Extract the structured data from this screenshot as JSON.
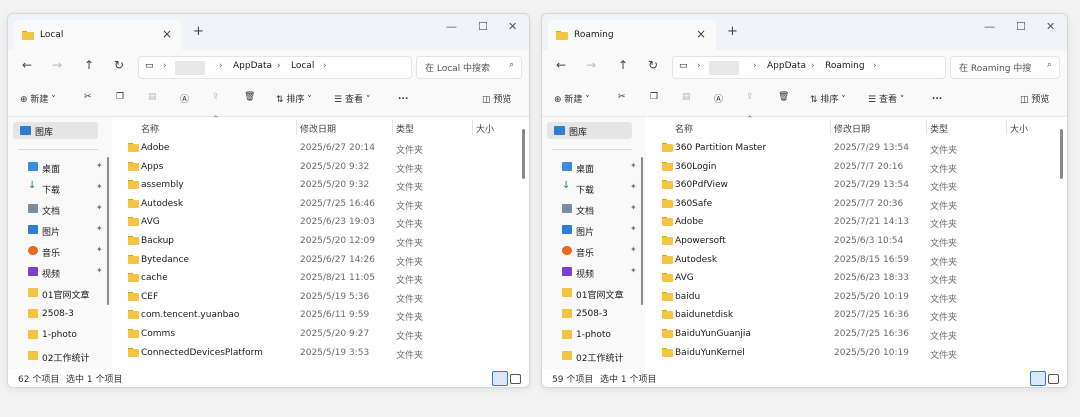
{
  "windows": [
    {
      "tab_title": "Local",
      "path": [
        "AppData",
        "Local"
      ],
      "search_placeholder": "在 Local 中搜索",
      "toolbar": {
        "new": "新建",
        "sort": "排序",
        "view": "查看",
        "more": "...",
        "preview": "预览"
      },
      "columns": {
        "name": "名称",
        "date": "修改日期",
        "type": "类型",
        "size": "大小"
      },
      "sidebar": {
        "gallery": "图库",
        "items": [
          "桌面",
          "下载",
          "文档",
          "图片",
          "音乐",
          "视频",
          "01官网文章",
          "2508-3",
          "1-photo",
          "02工作统计"
        ]
      },
      "files": [
        {
          "name": "Adobe",
          "date": "2025/6/27 20:14",
          "type": "文件夹"
        },
        {
          "name": "Apps",
          "date": "2025/5/20 9:32",
          "type": "文件夹"
        },
        {
          "name": "assembly",
          "date": "2025/5/20 9:32",
          "type": "文件夹"
        },
        {
          "name": "Autodesk",
          "date": "2025/7/25 16:46",
          "type": "文件夹"
        },
        {
          "name": "AVG",
          "date": "2025/6/23 19:03",
          "type": "文件夹"
        },
        {
          "name": "Backup",
          "date": "2025/5/20 12:09",
          "type": "文件夹"
        },
        {
          "name": "Bytedance",
          "date": "2025/6/27 14:26",
          "type": "文件夹"
        },
        {
          "name": "cache",
          "date": "2025/8/21 11:05",
          "type": "文件夹"
        },
        {
          "name": "CEF",
          "date": "2025/5/19 5:36",
          "type": "文件夹"
        },
        {
          "name": "com.tencent.yuanbao",
          "date": "2025/6/11 9:59",
          "type": "文件夹"
        },
        {
          "name": "Comms",
          "date": "2025/5/20 9:27",
          "type": "文件夹"
        },
        {
          "name": "ConnectedDevicesPlatform",
          "date": "2025/5/19 3:53",
          "type": "文件夹"
        }
      ],
      "status": {
        "count": "62 个项目",
        "selected": "选中 1 个项目"
      }
    },
    {
      "tab_title": "Roaming",
      "path": [
        "AppData",
        "Roaming"
      ],
      "search_placeholder": "在 Roaming 中搜",
      "toolbar": {
        "new": "新建",
        "sort": "排序",
        "view": "查看",
        "more": "...",
        "preview": "预览"
      },
      "columns": {
        "name": "名称",
        "date": "修改日期",
        "type": "类型",
        "size": "大小"
      },
      "sidebar": {
        "gallery": "图库",
        "items": [
          "桌面",
          "下载",
          "文档",
          "图片",
          "音乐",
          "视频",
          "01官网文章",
          "2508-3",
          "1-photo",
          "02工作统计"
        ]
      },
      "files": [
        {
          "name": "360 Partition Master",
          "date": "2025/7/29 13:54",
          "type": "文件夹"
        },
        {
          "name": "360Login",
          "date": "2025/7/7 20:16",
          "type": "文件夹"
        },
        {
          "name": "360PdfView",
          "date": "2025/7/29 13:54",
          "type": "文件夹"
        },
        {
          "name": "360Safe",
          "date": "2025/7/7 20:36",
          "type": "文件夹"
        },
        {
          "name": "Adobe",
          "date": "2025/7/21 14:13",
          "type": "文件夹"
        },
        {
          "name": "Apowersoft",
          "date": "2025/6/3 10:54",
          "type": "文件夹"
        },
        {
          "name": "Autodesk",
          "date": "2025/8/15 16:59",
          "type": "文件夹"
        },
        {
          "name": "AVG",
          "date": "2025/6/23 18:33",
          "type": "文件夹"
        },
        {
          "name": "baidu",
          "date": "2025/5/20 10:19",
          "type": "文件夹"
        },
        {
          "name": "baidunetdisk",
          "date": "2025/7/25 16:36",
          "type": "文件夹"
        },
        {
          "name": "BaiduYunGuanjia",
          "date": "2025/7/25 16:36",
          "type": "文件夹"
        },
        {
          "name": "BaiduYunKernel",
          "date": "2025/5/20 10:19",
          "type": "文件夹"
        }
      ],
      "status": {
        "count": "59 个项目",
        "selected": "选中 1 个项目"
      }
    }
  ],
  "colors": {
    "folder": "#f4c542",
    "accent": "#2d7dd2",
    "selection": "#e5e5e5"
  },
  "icons": [
    "folder-icon",
    "close-icon",
    "plus-icon",
    "minimize-icon",
    "maximize-icon",
    "back-icon",
    "forward-icon",
    "up-icon",
    "refresh-icon",
    "monitor-icon",
    "search-icon",
    "new-icon",
    "cut-icon",
    "copy-icon",
    "paste-icon",
    "rename-icon",
    "share-icon",
    "delete-icon",
    "sort-icon",
    "view-icon",
    "preview-icon",
    "pin-icon",
    "details-view-icon",
    "tiles-view-icon"
  ]
}
